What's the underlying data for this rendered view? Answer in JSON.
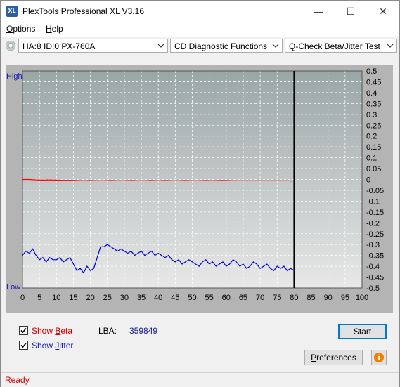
{
  "window": {
    "title": "PlexTools Professional XL V3.16",
    "app_icon_text": "XL",
    "minimize_glyph": "—",
    "maximize_glyph": "☐",
    "close_glyph": "✕"
  },
  "menu": {
    "options": {
      "underline": "O",
      "rest": "ptions"
    },
    "help": {
      "underline": "H",
      "rest": "elp"
    }
  },
  "toolbar": {
    "drive": "HA:8 ID:0  PX-760A",
    "function": "CD Diagnostic Functions",
    "test": "Q-Check Beta/Jitter Test"
  },
  "chart_data": {
    "type": "line",
    "y_high_label": "High",
    "y_low_label": "Low",
    "x_ticks": [
      "0",
      "5",
      "10",
      "15",
      "20",
      "25",
      "30",
      "35",
      "40",
      "45",
      "50",
      "55",
      "60",
      "65",
      "70",
      "75",
      "80",
      "85",
      "90",
      "95",
      "100"
    ],
    "y_ticks": [
      "0.5",
      "0.45",
      "0.4",
      "0.35",
      "0.3",
      "0.25",
      "0.2",
      "0.15",
      "0.1",
      "0.05",
      "0",
      "-0.05",
      "-0.1",
      "-0.15",
      "-0.2",
      "-0.25",
      "-0.3",
      "-0.35",
      "-0.4",
      "-0.45",
      "-0.5"
    ],
    "xlim": [
      0,
      100
    ],
    "ylim": [
      -0.5,
      0.5
    ],
    "scan_end_x": 80,
    "grid": true,
    "colors": {
      "background": "#9aa6a6",
      "background_light": "#e8e8e8",
      "grid": "#ffffff",
      "beta": "#ff0000",
      "jitter": "#0000cc"
    },
    "series": [
      {
        "key": "beta",
        "x": [
          0,
          2,
          4,
          6,
          8,
          10,
          12,
          14,
          16,
          18,
          20,
          22,
          24,
          26,
          28,
          30,
          32,
          34,
          36,
          38,
          40,
          42,
          44,
          46,
          48,
          50,
          52,
          54,
          56,
          58,
          60,
          62,
          64,
          66,
          68,
          70,
          72,
          74,
          76,
          78,
          80
        ],
        "values": [
          0.0,
          0.0,
          -0.002,
          -0.003,
          -0.002,
          -0.003,
          -0.004,
          -0.004,
          -0.005,
          -0.006,
          -0.005,
          -0.006,
          -0.006,
          -0.005,
          -0.006,
          -0.006,
          -0.005,
          -0.006,
          -0.006,
          -0.005,
          -0.006,
          -0.005,
          -0.006,
          -0.006,
          -0.005,
          -0.006,
          -0.006,
          -0.005,
          -0.006,
          -0.005,
          -0.005,
          -0.006,
          -0.006,
          -0.006,
          -0.006,
          -0.006,
          -0.006,
          -0.006,
          -0.006,
          -0.006,
          -0.007
        ]
      },
      {
        "key": "jitter",
        "x": [
          0,
          1,
          2,
          3,
          4,
          5,
          6,
          7,
          8,
          9,
          10,
          11,
          12,
          13,
          14,
          15,
          16,
          17,
          18,
          19,
          20,
          21,
          22,
          23,
          24,
          25,
          26,
          27,
          28,
          29,
          30,
          31,
          32,
          33,
          34,
          35,
          36,
          37,
          38,
          39,
          40,
          41,
          42,
          43,
          44,
          45,
          46,
          47,
          48,
          49,
          50,
          51,
          52,
          53,
          54,
          55,
          56,
          57,
          58,
          59,
          60,
          61,
          62,
          63,
          64,
          65,
          66,
          67,
          68,
          69,
          70,
          71,
          72,
          73,
          74,
          75,
          76,
          77,
          78,
          79,
          80
        ],
        "values": [
          -0.35,
          -0.33,
          -0.34,
          -0.32,
          -0.35,
          -0.37,
          -0.36,
          -0.38,
          -0.36,
          -0.37,
          -0.37,
          -0.36,
          -0.38,
          -0.37,
          -0.36,
          -0.39,
          -0.42,
          -0.41,
          -0.43,
          -0.4,
          -0.42,
          -0.41,
          -0.36,
          -0.31,
          -0.31,
          -0.3,
          -0.31,
          -0.32,
          -0.33,
          -0.32,
          -0.33,
          -0.34,
          -0.33,
          -0.35,
          -0.34,
          -0.33,
          -0.35,
          -0.34,
          -0.33,
          -0.35,
          -0.34,
          -0.35,
          -0.36,
          -0.35,
          -0.37,
          -0.38,
          -0.37,
          -0.39,
          -0.38,
          -0.37,
          -0.38,
          -0.39,
          -0.4,
          -0.38,
          -0.37,
          -0.39,
          -0.38,
          -0.4,
          -0.39,
          -0.38,
          -0.4,
          -0.39,
          -0.37,
          -0.38,
          -0.4,
          -0.39,
          -0.41,
          -0.4,
          -0.38,
          -0.39,
          -0.41,
          -0.4,
          -0.39,
          -0.41,
          -0.42,
          -0.4,
          -0.41,
          -0.4,
          -0.42,
          -0.41,
          -0.42
        ]
      }
    ]
  },
  "controls": {
    "show_beta": {
      "prefix": "Show ",
      "underline": "B",
      "rest": "eta",
      "checked": true
    },
    "show_jitter": {
      "prefix": "Show ",
      "underline": "J",
      "rest": "itter",
      "checked": true
    },
    "lba_label": "LBA:",
    "lba_value": "359849",
    "start": "Start",
    "preferences": {
      "underline": "P",
      "rest": "references"
    },
    "info_glyph": "i"
  },
  "status": "Ready"
}
